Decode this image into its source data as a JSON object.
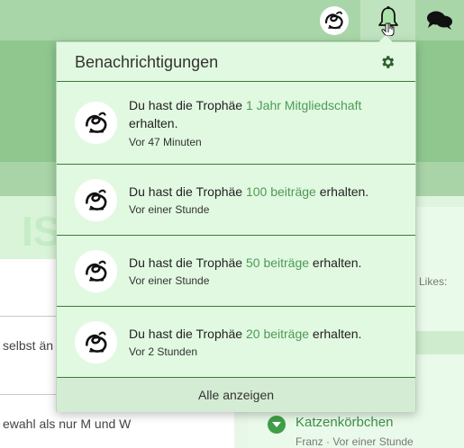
{
  "topbar": {
    "user_avatar_icon": "monogram-avatar-icon",
    "bell_icon": "bell-icon",
    "chat_icon": "chat-bubbles-icon",
    "accent_color": "#3c7a3c"
  },
  "background": {
    "faded_title": "IS",
    "row_text_1": "selbst än",
    "row_text_2": "ewahl als nur M und W",
    "likes_label": "Likes:",
    "category_title": "Katzenkörbchen",
    "category_meta": "Franz · Vor einer Stunde"
  },
  "popup": {
    "title": "Benachrichtigungen",
    "settings_icon": "gear-icon",
    "footer_label": "Alle anzeigen",
    "notifications": [
      {
        "prefix": "Du hast die Trophäe ",
        "trophy": "1 Jahr Mitgliedschaft",
        "suffix": " erhalten.",
        "time": "Vor 47 Minuten"
      },
      {
        "prefix": "Du hast die Trophäe ",
        "trophy": "100 beiträge",
        "suffix": " erhalten.",
        "time": "Vor einer Stunde"
      },
      {
        "prefix": "Du hast die Trophäe ",
        "trophy": "50 beiträge",
        "suffix": " erhalten.",
        "time": "Vor einer Stunde"
      },
      {
        "prefix": "Du hast die Trophäe ",
        "trophy": "20 beiträge",
        "suffix": " erhalten.",
        "time": "Vor 2 Stunden"
      }
    ]
  }
}
